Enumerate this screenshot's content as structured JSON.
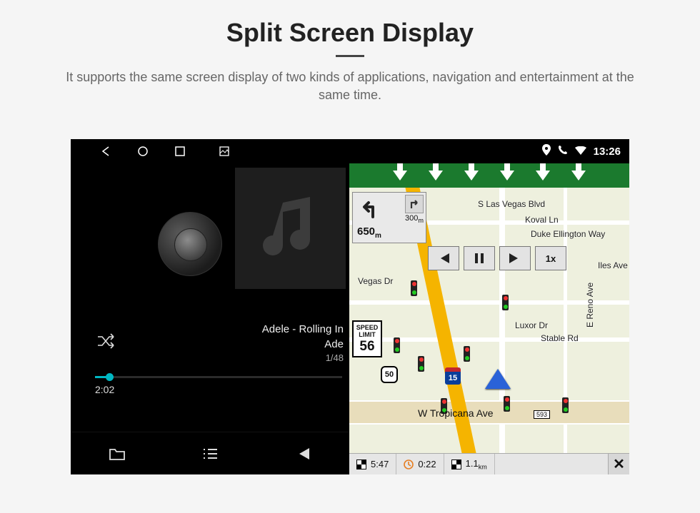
{
  "header": {
    "title": "Split Screen Display",
    "subtitle": "It supports the same screen display of two kinds of applications, navigation and entertainment at the same time."
  },
  "status_bar": {
    "time": "13:26"
  },
  "music": {
    "track_title": "Adele - Rolling In",
    "artist": "Ade",
    "track_index": "1/48",
    "elapsed": "2:02"
  },
  "nav": {
    "turn_distance_m": "300",
    "turn_distance_unit": "m",
    "turn_total": "650",
    "turn_total_unit": "m",
    "speed_limit_label": "SPEED LIMIT",
    "speed_limit": "56",
    "playback_speed": "1x",
    "interstate": "15",
    "route": "50",
    "exit_593": "593",
    "streets": {
      "s_las_vegas": "S Las Vegas Blvd",
      "tropicana": "W Tropicana Ave",
      "koval": "Koval Ln",
      "duke": "Duke Ellington Way",
      "luxor": "Luxor Dr",
      "stable": "Stable Rd",
      "reno": "E Reno Ave",
      "vegas_dr": "Vegas Dr",
      "iles": "Iles Ave"
    },
    "footer": {
      "eta": "5:47",
      "time_remain": "0:22",
      "distance": "1.1",
      "distance_unit": "km"
    }
  }
}
